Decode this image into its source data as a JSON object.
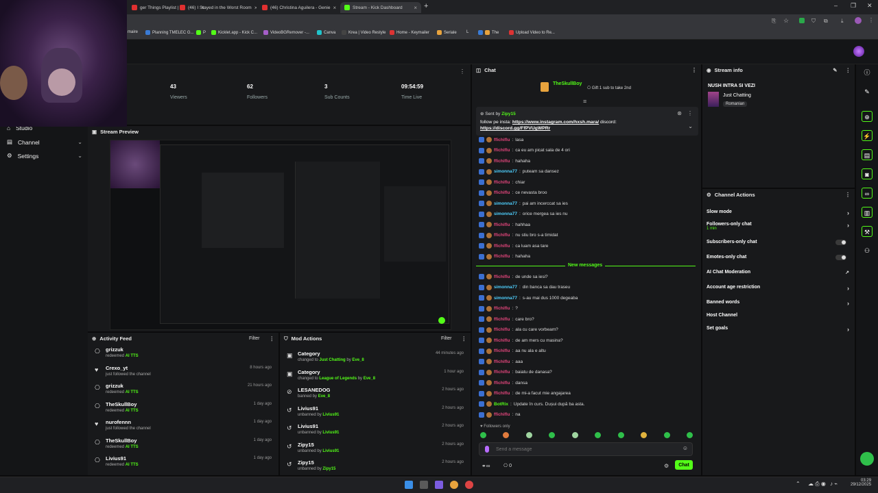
{
  "browser": {
    "tabs": [
      {
        "label": "ger Things Playlist |",
        "color": "#e03030"
      },
      {
        "label": "(46) I Stayed in the Worst Room",
        "color": "#e03030"
      },
      {
        "label": "(46) Christina Aguilera - Genie",
        "color": "#e03030"
      },
      {
        "label": "Stream - Kick Dashboard",
        "color": "#53fc18",
        "active": true
      }
    ],
    "new_tab": "+",
    "bookmarks": [
      "maire",
      "Planning TMELEC G...",
      "P",
      "Kicklet.app - Kick C...",
      "VideoBGRemover -...",
      "Canva",
      "Krea | Video Restyle",
      "Home - Keymailer",
      "Seriale",
      "L",
      "The",
      "Upload Video to Re..."
    ]
  },
  "sidebar": {
    "items": [
      {
        "label": "Studio",
        "icon": "home-icon"
      },
      {
        "label": "Channel",
        "icon": "channel-icon"
      },
      {
        "label": "Settings",
        "icon": "gear-icon"
      }
    ]
  },
  "stats": [
    {
      "value": "43",
      "label": "Viewers"
    },
    {
      "value": "62",
      "label": "Followers"
    },
    {
      "value": "3",
      "label": "Sub Counts"
    },
    {
      "value": "09:54:59",
      "label": "Time Live"
    }
  ],
  "preview": {
    "title": "Stream Preview"
  },
  "activity": {
    "title": "Activity Feed",
    "filter": "Filter",
    "items": [
      {
        "name": "grizzuk",
        "sub_pre": "redeemed ",
        "sub_hl": "AI TTS",
        "time": "",
        "icon": "gift-icon"
      },
      {
        "name": "Crexo_yt",
        "sub_pre": "just followed the channel",
        "sub_hl": "",
        "time": "8 hours ago",
        "icon": "heart-icon"
      },
      {
        "name": "grizzuk",
        "sub_pre": "redeemed ",
        "sub_hl": "AI TTS",
        "time": "21 hours ago",
        "icon": "gift-icon"
      },
      {
        "name": "TheSkullBoy",
        "sub_pre": "redeemed ",
        "sub_hl": "AI TTS",
        "time": "1 day ago",
        "icon": "gift-icon"
      },
      {
        "name": "nurofennn",
        "sub_pre": "just followed the channel",
        "sub_hl": "",
        "time": "1 day ago",
        "icon": "heart-icon"
      },
      {
        "name": "TheSkullBoy",
        "sub_pre": "redeemed ",
        "sub_hl": "AI TTS",
        "time": "1 day ago",
        "icon": "gift-icon"
      },
      {
        "name": "Livius91",
        "sub_pre": "redeemed ",
        "sub_hl": "AI TTS",
        "time": "1 day ago",
        "icon": "gift-icon"
      }
    ]
  },
  "mod": {
    "title": "Mod Actions",
    "filter": "Filter",
    "items": [
      {
        "name": "Category",
        "sub_pre": "changed to ",
        "sub_hl": "Just Chatting",
        "sub_mid": " by ",
        "sub_hl2": "Eve_8",
        "time": "44 minutes ago",
        "icon": "category-icon"
      },
      {
        "name": "Category",
        "sub_pre": "changed to ",
        "sub_hl": "League of Legends",
        "sub_mid": " by ",
        "sub_hl2": "Eve_8",
        "time": "1 hour ago",
        "icon": "category-icon"
      },
      {
        "name": "LESANEDOG",
        "sub_pre": "banned by ",
        "sub_hl": "Eve_8",
        "sub_mid": "",
        "sub_hl2": "",
        "time": "2 hours ago",
        "icon": "ban-icon"
      },
      {
        "name": "Livius91",
        "sub_pre": "unbanned by ",
        "sub_hl": "Livius91",
        "sub_mid": "",
        "sub_hl2": "",
        "time": "2 hours ago",
        "icon": "undo-icon"
      },
      {
        "name": "Livius91",
        "sub_pre": "unbanned by ",
        "sub_hl": "Livius91",
        "sub_mid": "",
        "sub_hl2": "",
        "time": "2 hours ago",
        "icon": "undo-icon"
      },
      {
        "name": "Zipy15",
        "sub_pre": "unbanned by ",
        "sub_hl": "Livius91",
        "sub_mid": "",
        "sub_hl2": "",
        "time": "2 hours ago",
        "icon": "undo-icon"
      },
      {
        "name": "Zipy15",
        "sub_pre": "unbanned by ",
        "sub_hl": "Zipy15",
        "sub_mid": "",
        "sub_hl2": "",
        "time": "2 hours ago",
        "icon": "undo-icon"
      }
    ]
  },
  "chat": {
    "title": "Chat",
    "gifter": "TheSkullBoy",
    "gift_text": "Gift 1 sub to take 2nd",
    "pinned_sender_label": "Sent by",
    "pinned_sender": "Zipy15",
    "pinned_text_pre": "follow pe insta: ",
    "pinned_link1": "https://www.instagram.com/hxsh.mara/",
    "pinned_text_mid": " discord:",
    "pinned_link2": "https://discord.gg/FfPVUgWPRr",
    "new_messages": "New messages",
    "followers_only": "Followers only",
    "input_placeholder": "Send a message",
    "send_button": "Chat",
    "user_count": "0",
    "messages_before": [
      {
        "user": "ffichiflu",
        "color": "#e0457b",
        "text": "lasa"
      },
      {
        "user": "ffichiflu",
        "color": "#e0457b",
        "text": "ca eu am picat sala de 4 ori"
      },
      {
        "user": "ffichiflu",
        "color": "#e0457b",
        "text": "hahaha"
      },
      {
        "user": "simonna77",
        "color": "#4fd1ff",
        "text": "puteam sa dansez"
      },
      {
        "user": "ffichiflu",
        "color": "#e0457b",
        "text": "chiar"
      },
      {
        "user": "ffichiflu",
        "color": "#e0457b",
        "text": "ce nevasta broo"
      },
      {
        "user": "simonna77",
        "color": "#4fd1ff",
        "text": "pai am incerccat sa ies"
      },
      {
        "user": "simonna77",
        "color": "#4fd1ff",
        "text": "orice mergea sa ies nu"
      },
      {
        "user": "ffichiflu",
        "color": "#e0457b",
        "text": "hahhaa"
      },
      {
        "user": "ffichiflu",
        "color": "#e0457b",
        "text": "nu stiu bro s-a timidat"
      },
      {
        "user": "ffichiflu",
        "color": "#e0457b",
        "text": "ca luam asa tare"
      },
      {
        "user": "ffichiflu",
        "color": "#e0457b",
        "text": "hahaha"
      }
    ],
    "messages_after": [
      {
        "user": "ffichiflu",
        "color": "#e0457b",
        "text": "de unde sa iesi?"
      },
      {
        "user": "simonna77",
        "color": "#4fd1ff",
        "text": "din banca sa dau traseu"
      },
      {
        "user": "simonna77",
        "color": "#4fd1ff",
        "text": "s-au mai dus 1000 degeaba"
      },
      {
        "user": "ffichiflu",
        "color": "#e0457b",
        "text": "?"
      },
      {
        "user": "ffichiflu",
        "color": "#e0457b",
        "text": "care bro?"
      },
      {
        "user": "ffichiflu",
        "color": "#e0457b",
        "text": "ala cu care vorbeam?"
      },
      {
        "user": "ffichiflu",
        "color": "#e0457b",
        "text": "de am mers cu masina?"
      },
      {
        "user": "ffichiflu",
        "color": "#e0457b",
        "text": "aa nu ala e altu"
      },
      {
        "user": "ffichiflu",
        "color": "#e0457b",
        "text": "aaa"
      },
      {
        "user": "ffichiflu",
        "color": "#e0457b",
        "text": "baiatu de danasa?"
      },
      {
        "user": "ffichiflu",
        "color": "#e0457b",
        "text": "dansa"
      },
      {
        "user": "ffichiflu",
        "color": "#e0457b",
        "text": "de mi-a facut mie angajarea"
      },
      {
        "user": "BotRix",
        "color": "#53fc18",
        "text": "Update în curs. Dușui după ba asta."
      },
      {
        "user": "ffichiflu",
        "color": "#e0457b",
        "text": "na"
      }
    ]
  },
  "stream_info": {
    "title": "Stream info",
    "stream_title": "NUSH INTRA SI VEZI",
    "category": "Just Chatting",
    "language": "Romanian"
  },
  "channel_actions": {
    "title": "Channel Actions",
    "items": [
      {
        "label": "Slow mode",
        "control": "arrow",
        "extra": ""
      },
      {
        "label": "Followers-only chat",
        "control": "arrow",
        "extra": "1 min"
      },
      {
        "label": "Subscribers-only chat",
        "control": "toggle",
        "extra": ""
      },
      {
        "label": "Emotes-only chat",
        "control": "toggle",
        "extra": ""
      },
      {
        "label": "AI Chat Moderation",
        "control": "link",
        "extra": ""
      },
      {
        "label": "Account age restriction",
        "control": "arrow",
        "extra": ""
      },
      {
        "label": "Banned words",
        "control": "arrow",
        "extra": ""
      },
      {
        "label": "Host Channel",
        "control": "none",
        "extra": ""
      },
      {
        "label": "Set goals",
        "control": "arrow",
        "extra": ""
      }
    ]
  },
  "taskbar": {
    "time": "03:29",
    "date": "29/12/2025"
  },
  "colors": {
    "accent": "#53fc18",
    "panel": "#18191b",
    "bg": "#0b0b0c"
  }
}
